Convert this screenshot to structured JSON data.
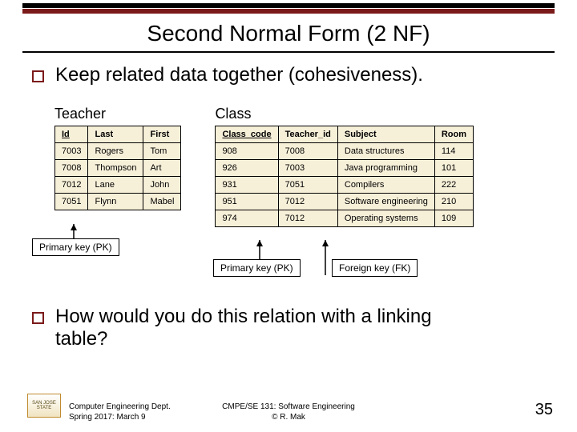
{
  "title": "Second Normal Form (2 NF)",
  "bullet1": "Keep related data together (cohesiveness).",
  "teacher": {
    "title": "Teacher",
    "headers": [
      "Id",
      "Last",
      "First"
    ],
    "pk_index": 0,
    "rows": [
      [
        "7003",
        "Rogers",
        "Tom"
      ],
      [
        "7008",
        "Thompson",
        "Art"
      ],
      [
        "7012",
        "Lane",
        "John"
      ],
      [
        "7051",
        "Flynn",
        "Mabel"
      ]
    ]
  },
  "class": {
    "title": "Class",
    "headers": [
      "Class_code",
      "Teacher_id",
      "Subject",
      "Room"
    ],
    "pk_index": 0,
    "rows": [
      [
        "908",
        "7008",
        "Data structures",
        "114"
      ],
      [
        "926",
        "7003",
        "Java programming",
        "101"
      ],
      [
        "931",
        "7051",
        "Compilers",
        "222"
      ],
      [
        "951",
        "7012",
        "Software engineering",
        "210"
      ],
      [
        "974",
        "7012",
        "Operating systems",
        "109"
      ]
    ]
  },
  "labels": {
    "pk1": "Primary key (PK)",
    "pk2": "Primary key (PK)",
    "fk": "Foreign key (FK)"
  },
  "bullet2": "How would you do this relation with a linking table?",
  "footer": {
    "left1": "Computer Engineering Dept.",
    "left2": "Spring 2017: March 9",
    "center1": "CMPE/SE 131: Software Engineering",
    "center2": "© R. Mak",
    "pagenum": "35",
    "logo_text": "SAN JOSE STATE"
  }
}
